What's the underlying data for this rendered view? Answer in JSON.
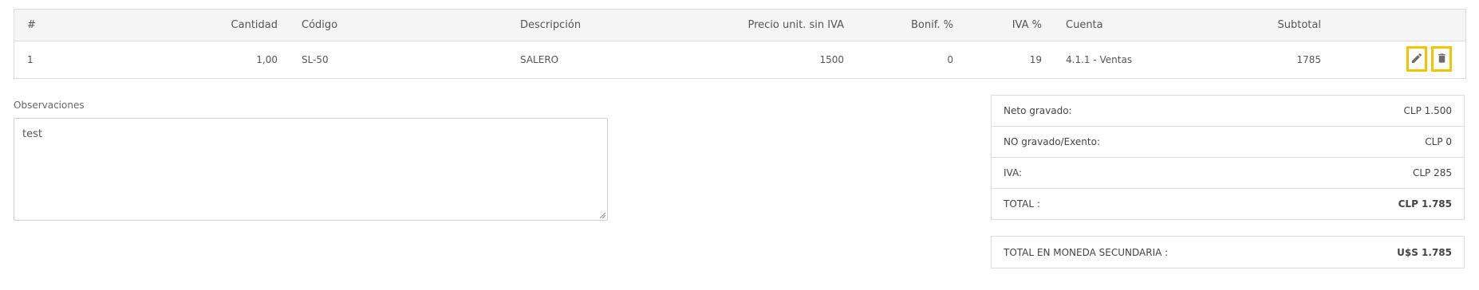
{
  "table": {
    "headers": {
      "num": "#",
      "cantidad": "Cantidad",
      "codigo": "Código",
      "descripcion": "Descripción",
      "precio": "Precio unit. sin IVA",
      "bonif": "Bonif. %",
      "iva": "IVA %",
      "cuenta": "Cuenta",
      "subtotal": "Subtotal"
    },
    "rows": [
      {
        "num": "1",
        "cantidad": "1,00",
        "codigo": "SL-50",
        "descripcion": "SALERO",
        "precio": "1500",
        "bonif": "0",
        "iva": "19",
        "cuenta": "4.1.1 - Ventas",
        "subtotal": "1785"
      }
    ],
    "row_actions": {
      "edit_icon": "pencil-icon",
      "delete_icon": "trash-icon"
    }
  },
  "observaciones": {
    "label": "Observaciones",
    "value": "test"
  },
  "totals": {
    "neto_label": "Neto gravado:",
    "neto_value": "CLP 1.500",
    "no_gravado_label": "NO gravado/Exento:",
    "no_gravado_value": "CLP 0",
    "iva_label": "IVA:",
    "iva_value": "CLP 285",
    "total_label": "TOTAL :",
    "total_value": "CLP 1.785"
  },
  "secondary": {
    "label": "TOTAL EN MONEDA SECUNDARIA :",
    "value": "U$S 1.785"
  },
  "colors": {
    "highlight": "#f5c400",
    "border": "#dcdcdc",
    "header_bg": "#f5f5f5"
  }
}
